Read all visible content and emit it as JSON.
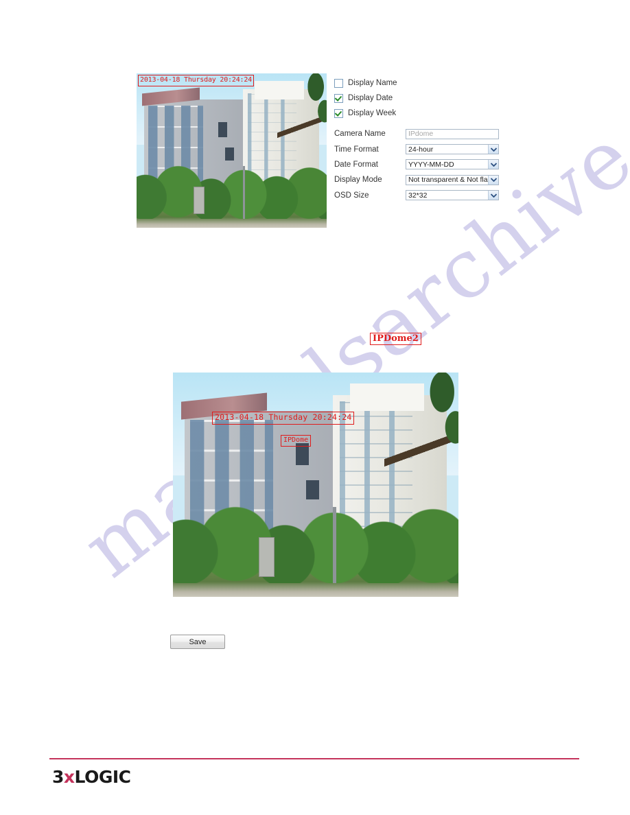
{
  "page": {
    "background": "#ffffff",
    "watermark_text": "manualsarchive.com",
    "watermark_color": "#cdcaea"
  },
  "preview_small": {
    "name": "camera-preview-small",
    "osd_datetime": "2013-04-18 Thursday 20:24:24"
  },
  "osd_form": {
    "checkboxes": [
      {
        "label": "Display Name",
        "checked": false
      },
      {
        "label": "Display Date",
        "checked": true
      },
      {
        "label": "Display Week",
        "checked": true
      }
    ],
    "fields": [
      {
        "label": "Camera Name",
        "type": "text",
        "value": "IPdome",
        "is_placeholder": true
      },
      {
        "label": "Time Format",
        "type": "select",
        "value": "24-hour",
        "is_placeholder": false
      },
      {
        "label": "Date Format",
        "type": "select",
        "value": "YYYY-MM-DD",
        "is_placeholder": false
      },
      {
        "label": "Display Mode",
        "type": "select",
        "value": "Not transparent & Not flash",
        "is_placeholder": false
      },
      {
        "label": "OSD Size",
        "type": "select",
        "value": "32*32",
        "is_placeholder": false
      }
    ]
  },
  "floating_osd": {
    "text": "IPDome2",
    "color": "#e01b1b"
  },
  "preview_large": {
    "name": "camera-preview-large",
    "osd_datetime": "2013-04-18 Thursday 20:24:24",
    "osd_name": "IPDome"
  },
  "actions": {
    "save_label": "Save"
  },
  "footer": {
    "logo_prefix": "3",
    "logo_x": "x",
    "logo_suffix": "LOGIC",
    "rule_color": "#c4325b"
  }
}
